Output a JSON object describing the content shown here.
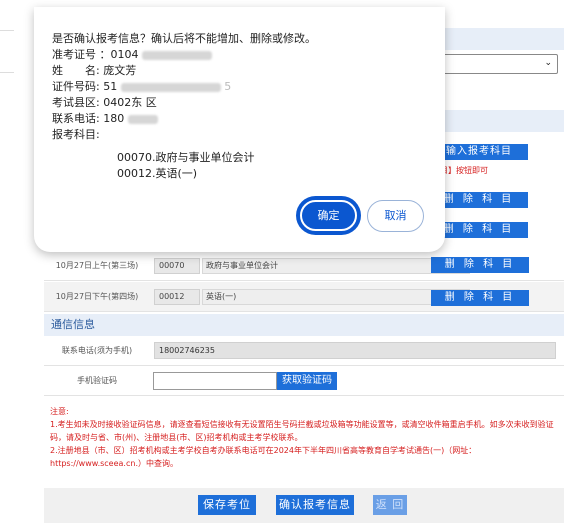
{
  "background": {
    "add_subject_button": "输入报考科目",
    "add_subject_hint": "目】按钮即可",
    "delete_label": "删 除 科 目",
    "subjects": [
      {
        "time": "10月27日上午(第三场)",
        "code": "00070",
        "name": "政府与事业单位会计"
      },
      {
        "time": "10月27日下午(第四场)",
        "code": "00012",
        "name": "英语(一)"
      }
    ],
    "contact_section_title": "通信信息",
    "phone_label": "联系电话(须为手机)",
    "phone_value": "18002746235",
    "verify_label": "手机验证码",
    "verify_button": "获取验证码",
    "notice_title": "注意:",
    "notice_1": "1.考生如未及时接收验证码信息，请逐查看短信接收有无设置陌生号码拦截或垃圾箱等功能设置等，或清空收件箱重启手机。如多次未收到验证码，请及时与省、市(州)、注册地县(市、区)招考机构或主考学校联系。",
    "notice_2": "2.注册地县（市、区）招考机构或主考学校自考办联系电话可在2024年下半年四川省高等教育自学考试通告(一)（网址：https://www.sceea.cn.）中查询。",
    "save_button": "保存考位",
    "confirm_button": "确认报考信息",
    "back_button": "返 回"
  },
  "dialog": {
    "message": "是否确认报考信息？确认后将不能增加、删除或修改。",
    "ticket_label": "准考证号",
    "ticket_value": "：0104",
    "name_label": "姓　　名:",
    "name_value": "庞文芳",
    "id_label": "证件号码:",
    "id_value": "51",
    "id_suffix": "5",
    "area_label": "考试县区:",
    "area_value": "0402东 区",
    "phone_label": "联系电话:",
    "phone_value": "180",
    "subjects_label": "报考科目:",
    "subject_1": "00070.政府与事业单位会计",
    "subject_2": "00012.英语(一)",
    "ok_button": "确定",
    "cancel_button": "取消"
  },
  "colors": {
    "primary_blue": "#1e6fd9",
    "dialog_blue": "#0b57d0",
    "notice_red": "#d62020",
    "section_bg": "#e7eef8"
  }
}
